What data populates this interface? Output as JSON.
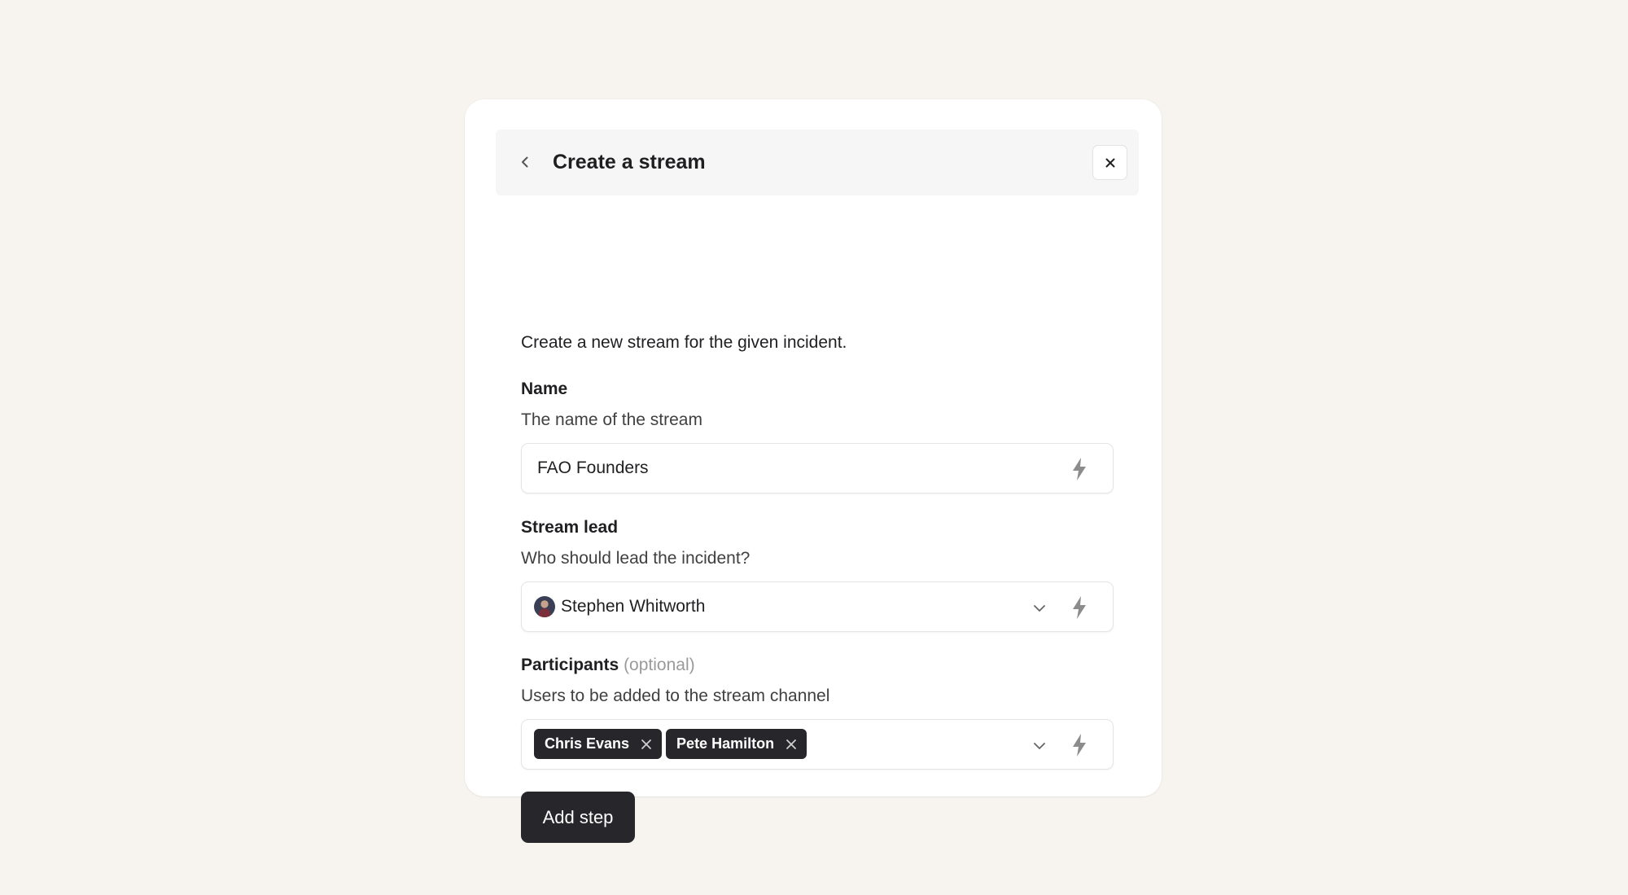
{
  "dialog": {
    "title": "Create a stream",
    "description": "Create a new stream for the given incident."
  },
  "fields": {
    "name": {
      "label": "Name",
      "description": "The name of the stream",
      "value": "FAO Founders"
    },
    "stream_lead": {
      "label": "Stream lead",
      "description": "Who should lead the incident?",
      "value": "Stephen Whitworth"
    },
    "participants": {
      "label": "Participants",
      "optional_tag": "(optional)",
      "description": "Users to be added to the stream channel",
      "chips": [
        "Chris Evans",
        "Pete Hamilton"
      ]
    }
  },
  "actions": {
    "add_step_label": "Add step"
  },
  "icons": {
    "back": "chevron-left-icon",
    "close": "close-icon",
    "variable": "lightning-bolt-icon",
    "dropdown": "chevron-down-icon",
    "remove_chip": "close-icon"
  },
  "colors": {
    "page_background": "#f7f4f0",
    "card_background": "#ffffff",
    "header_background": "#f6f6f6",
    "chip_background": "#27272b",
    "button_background": "#27272b",
    "muted_text": "#9a9a9a"
  }
}
